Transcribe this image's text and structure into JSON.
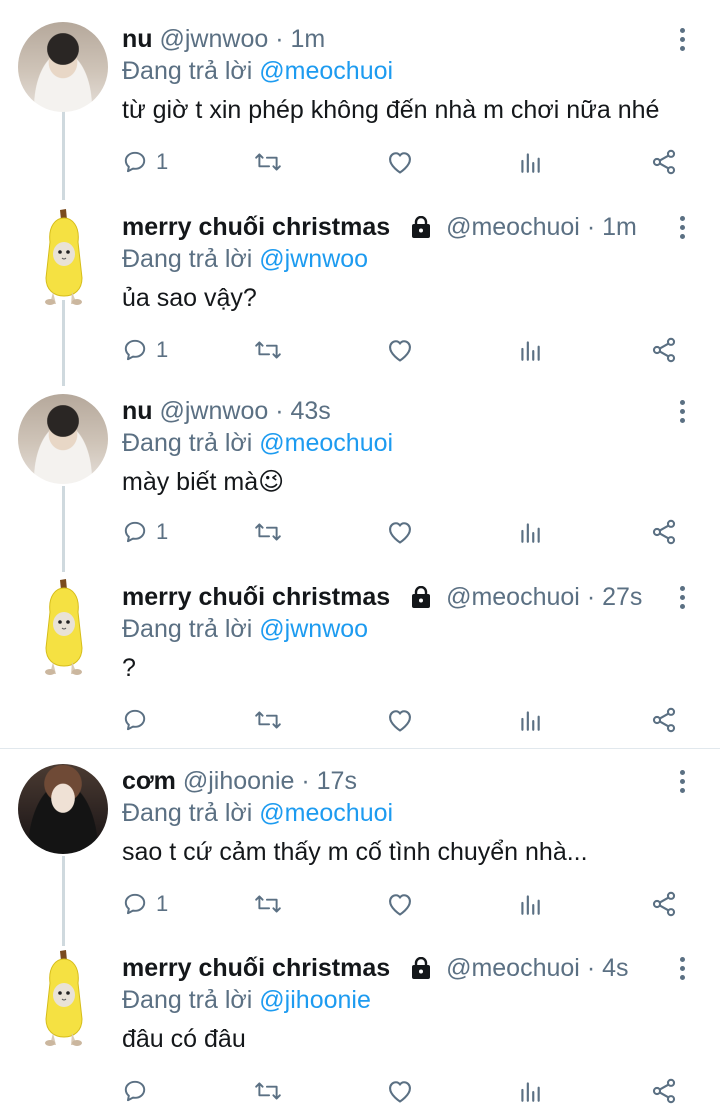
{
  "reply_prefix": "Đang trả lời",
  "tweets": [
    {
      "name": "nu",
      "handle": "@jwnwoo",
      "sep": "·",
      "time": "1m",
      "reply_to": "@meochuoi",
      "text": "từ giờ t xin phép không đến nhà m chơi nữa nhé",
      "reply_count": "1",
      "avatar": "photo-nu",
      "locked": false
    },
    {
      "name": "merry chuối christmas",
      "handle": "@meochuoi",
      "sep": "·",
      "time": "1m",
      "reply_to": "@jwnwoo",
      "text": "ủa sao vậy?",
      "reply_count": "1",
      "avatar": "banana-cat",
      "locked": true
    },
    {
      "name": "nu",
      "handle": "@jwnwoo",
      "sep": "·",
      "time": "43s",
      "reply_to": "@meochuoi",
      "text": "mày biết mà",
      "emoji": "😉",
      "reply_count": "1",
      "avatar": "photo-nu",
      "locked": false
    },
    {
      "name": "merry chuối christmas",
      "handle": "@meochuoi",
      "sep": "·",
      "time": "27s",
      "reply_to": "@jwnwoo",
      "text": "?",
      "reply_count": "",
      "avatar": "banana-cat",
      "locked": true
    },
    {
      "name": "cơm",
      "handle": "@jihoonie",
      "sep": "·",
      "time": "17s",
      "reply_to": "@meochuoi",
      "text": "sao t cứ cảm thấy m cố tình chuyển nhà...",
      "reply_count": "1",
      "avatar": "photo-com",
      "locked": false
    },
    {
      "name": "merry chuối christmas",
      "handle": "@meochuoi",
      "sep": "·",
      "time": "4s",
      "reply_to": "@jihoonie",
      "text": "đâu có đâu",
      "reply_count": "",
      "avatar": "banana-cat",
      "locked": true
    }
  ],
  "icons": {
    "reply": "reply-icon",
    "retweet": "retweet-icon",
    "like": "heart-icon",
    "analytics": "analytics-icon",
    "share": "share-icon",
    "more": "more-icon",
    "lock": "lock-icon"
  },
  "colors": {
    "mention": "#1d9bf0",
    "secondary_text": "#5b7083",
    "thread_line": "#cfd9de",
    "banana": "#f5e142"
  }
}
